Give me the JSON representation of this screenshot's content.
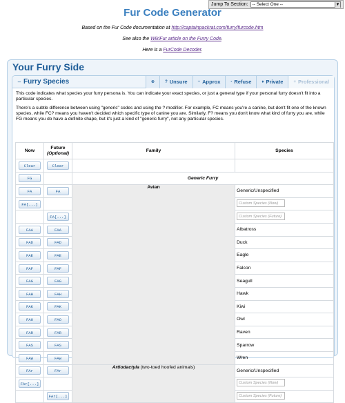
{
  "jump": {
    "label": "Jump To Section:",
    "selected": "-- Select One --"
  },
  "title": "Fur Code Generator",
  "intro": {
    "line1_prefix": "Based on the Fur Code documentation at ",
    "line1_link": "http://captainpackrat.com/furry/furcode.htm",
    "line2_prefix": "See also the ",
    "line2_link": "WikiFur article on the Furry Code",
    "line2_suffix": ".",
    "line3_prefix": "Here is a ",
    "line3_link": "FurCode Decoder",
    "line3_suffix": "."
  },
  "panel_title": "Your Furry Side",
  "section": {
    "title": "Furry Species",
    "tabs": [
      {
        "label": "",
        "icon": "⊕"
      },
      {
        "label": "Unsure",
        "icon": "?"
      },
      {
        "label": "Approx",
        "icon": "~"
      },
      {
        "label": "Refuse",
        "icon": "-"
      },
      {
        "label": "Private",
        "icon": "♦"
      },
      {
        "label": "Professional",
        "icon": "+"
      }
    ],
    "desc1": "This code indicates what species your furry persona is. You can indicate your exact species, or just a general type if your personal furry doesn't fit into a particular species.",
    "desc2": "There's a subtle difference between using \"generic\" codes and using the ? modifier. For example, FC means you're a canine, but don't fit one of the known species, while FC? means you haven't decided which specific type of canine you are. Similarly, F? means you don't know what kind of furry you are, while FG means you do have a definite shape, but it's just a kind of \"generic furry\", not any particular species."
  },
  "table": {
    "headers": {
      "now": "Now",
      "future": "Future",
      "optional": "(Optional)",
      "family": "Family",
      "species": "Species"
    },
    "clear": "Clear",
    "fg": "FG",
    "generic_furry": "Generic Furry",
    "avian": "Avian",
    "generic_unspecified": "Generic/Unspecified",
    "custom_now": "Custom Species (Now)",
    "custom_future": "Custom Species (Future)",
    "fa": "FA",
    "fa_custom": "FA[...]",
    "avian_rows": [
      {
        "code": "FAA",
        "name": "Albatross"
      },
      {
        "code": "FAD",
        "name": "Duck"
      },
      {
        "code": "FAE",
        "name": "Eagle"
      },
      {
        "code": "FAF",
        "name": "Falcon"
      },
      {
        "code": "FAG",
        "name": "Seagull"
      },
      {
        "code": "FAH",
        "name": "Hawk"
      },
      {
        "code": "FAK",
        "name": "Kiwi"
      },
      {
        "code": "FAO",
        "name": "Owl"
      },
      {
        "code": "FAR",
        "name": "Raven"
      },
      {
        "code": "FAS",
        "name": "Sparrow"
      },
      {
        "code": "FAW",
        "name": "Wren"
      }
    ],
    "artio_family_name": "Artiodactyla",
    "artio_family_desc": " (two-toed hoofed animals)",
    "far": "FAr",
    "far_custom": "FAr[...]"
  }
}
